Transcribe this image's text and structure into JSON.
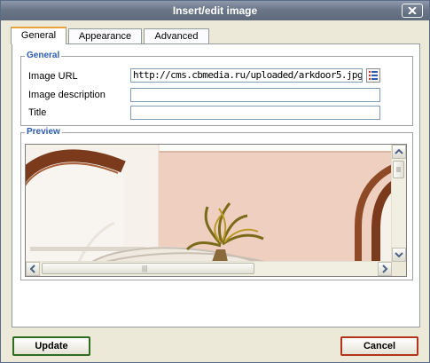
{
  "dialog": {
    "title": "Insert/edit image"
  },
  "tabs": [
    {
      "label": "General",
      "active": true
    },
    {
      "label": "Appearance",
      "active": false
    },
    {
      "label": "Advanced",
      "active": false
    }
  ],
  "general": {
    "legend": "General",
    "image_url_label": "Image URL",
    "image_url_value": "http://cms.cbmedia.ru/uploaded/arkdoor5.jpg",
    "image_description_label": "Image description",
    "image_description_value": "",
    "title_label": "Title",
    "title_value": ""
  },
  "preview": {
    "legend": "Preview",
    "scroll_grip": "|||"
  },
  "buttons": {
    "update": "Update",
    "cancel": "Cancel"
  },
  "colors": {
    "legend": "#2b5bb0",
    "active_tab_accent": "#e8a33d",
    "update_border": "#2f6c1f",
    "cancel_border": "#b3331b"
  },
  "icons": {
    "close": "close-icon",
    "browse": "browse-list-icon"
  }
}
